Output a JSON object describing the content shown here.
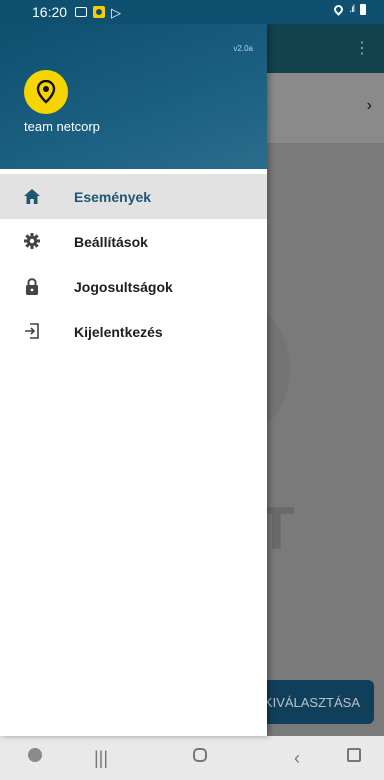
{
  "status_bar": {
    "time": "16:20"
  },
  "drawer": {
    "version": "v2.0a",
    "team_name": "team netcorp",
    "menu": [
      {
        "label": "Események",
        "icon": "home-icon",
        "active": true
      },
      {
        "label": "Beállítások",
        "icon": "gear-icon",
        "active": false
      },
      {
        "label": "Jogosultságok",
        "icon": "lock-icon",
        "active": false
      },
      {
        "label": "Kijelentkezés",
        "icon": "logout-icon",
        "active": false
      }
    ]
  },
  "background": {
    "button_label": "KIVÁLASZTÁSA"
  },
  "colors": {
    "header": "#0f4f70",
    "accent": "#1f5672",
    "logo": "#f5d400"
  }
}
